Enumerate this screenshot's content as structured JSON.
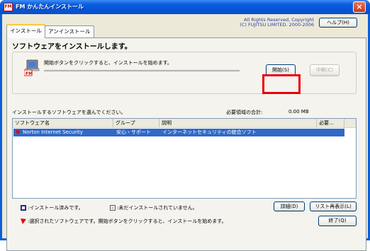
{
  "window": {
    "title": "FM かんたんインストール",
    "icon_label": "FM",
    "close_label": "×"
  },
  "tabs": [
    {
      "label": "インストール",
      "active": true
    },
    {
      "label": "アンインストール",
      "active": false
    }
  ],
  "copyright": {
    "line1": "All Rights Reserved, Copyright",
    "line2": "(C) FUJITSU LIMITED. 2000-2006"
  },
  "help_button": {
    "label": "ヘルプ(H)"
  },
  "heading": "ソフトウェアをインストールします。",
  "progress": {
    "message": "開始ボタンをクリックすると、インストールを始めます。",
    "value": 0
  },
  "start_button": {
    "label": "開始(S)"
  },
  "cancel_button": {
    "label": "中断(C)"
  },
  "select_label": "インストールするソフトウェアを選んでください。",
  "total": {
    "label": "必要領域の合計:",
    "value": "0.00 MB"
  },
  "list": {
    "columns": [
      "ソフトウェア名",
      "グループ",
      "説明",
      "必要..."
    ],
    "rows": [
      {
        "name": "Norton Internet Security",
        "group": "安心・サポート",
        "description": "インターネットセキュリティの統合ソフト",
        "size": "",
        "selected": true
      }
    ]
  },
  "buttons": {
    "detail": "詳細(D)",
    "list_redisplay": "リスト再表示(L)",
    "finish": "終了(Q)"
  },
  "legend": {
    "installed": ":インストール済みです。",
    "not_installed": ":未だインストールされていません。",
    "selected": ":選択されたソフトウェアです。開始ボタンをクリックすると、インストールを始めます。"
  },
  "colors": {
    "selection": "#3169c6",
    "highlight_box": "#e8000b",
    "titlebar": "#0554d8"
  }
}
